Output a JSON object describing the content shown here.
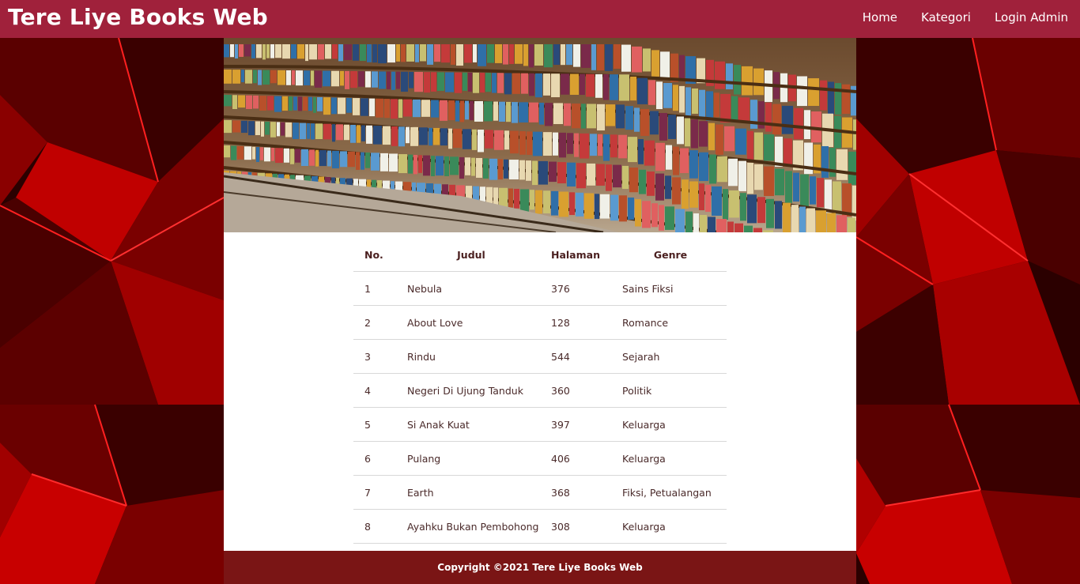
{
  "navbar": {
    "brand": "Tere Liye Books Web",
    "links": [
      {
        "label": "Home"
      },
      {
        "label": "Kategori"
      },
      {
        "label": "Login Admin"
      }
    ]
  },
  "colors": {
    "navbar_bg": "#a0213b",
    "footer_bg": "#7a1515",
    "background_accent": "#e00000"
  },
  "table": {
    "headers": [
      "No.",
      "Judul",
      "Halaman",
      "Genre"
    ],
    "rows": [
      [
        "1",
        "Nebula",
        "376",
        "Sains Fiksi"
      ],
      [
        "2",
        "About Love",
        "128",
        "Romance"
      ],
      [
        "3",
        "Rindu",
        "544",
        "Sejarah"
      ],
      [
        "4",
        "Negeri Di Ujung Tanduk",
        "360",
        "Politik"
      ],
      [
        "5",
        "Si Anak Kuat",
        "397",
        "Keluarga"
      ],
      [
        "6",
        "Pulang",
        "406",
        "Keluarga"
      ],
      [
        "7",
        "Earth",
        "368",
        "Fiksi, Petualangan"
      ],
      [
        "8",
        "Ayahku Bukan Pembohong",
        "308",
        "Keluarga"
      ]
    ]
  },
  "footer": {
    "text": "Copyright ©2021 Tere Liye Books Web"
  }
}
